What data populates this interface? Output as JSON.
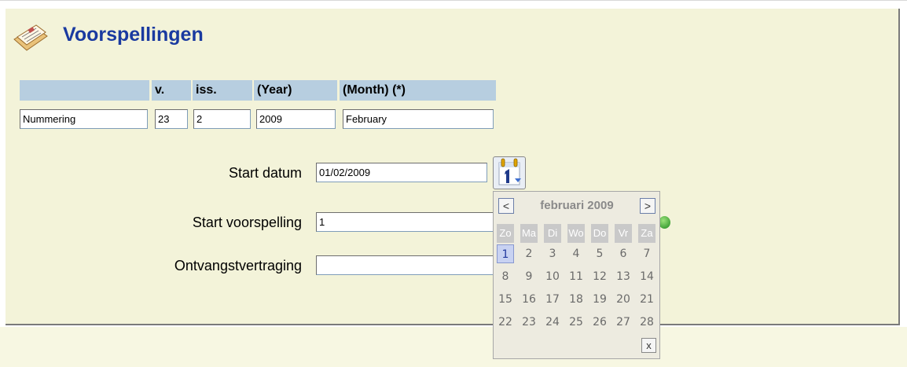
{
  "page": {
    "title": "Voorspellingen"
  },
  "table": {
    "headers": [
      "",
      "v.",
      "iss.",
      "(Year)",
      "(Month) (*)"
    ],
    "row": [
      "Nummering",
      "23",
      "2",
      "2009",
      "February"
    ]
  },
  "form": {
    "start_datum_label": "Start datum",
    "start_datum_value": "01/02/2009",
    "start_voorspelling_label": "Start voorspelling",
    "start_voorspelling_value": "1",
    "ontvangstvertraging_label": "Ontvangstvertraging",
    "ontvangstvertraging_value": ""
  },
  "calendar": {
    "button_icon": "calendar-icon",
    "prev_label": "<",
    "next_label": ">",
    "month_label": "februari 2009",
    "close_label": "x",
    "day_names": [
      "Zo",
      "Ma",
      "Di",
      "Wo",
      "Do",
      "Vr",
      "Za"
    ],
    "weeks": [
      [
        "1",
        "2",
        "3",
        "4",
        "5",
        "6",
        "7"
      ],
      [
        "8",
        "9",
        "10",
        "11",
        "12",
        "13",
        "14"
      ],
      [
        "15",
        "16",
        "17",
        "18",
        "19",
        "20",
        "21"
      ],
      [
        "22",
        "23",
        "24",
        "25",
        "26",
        "27",
        "28"
      ]
    ],
    "selected_day": "1"
  },
  "icons": {
    "logo": "newspaper-icon",
    "status": "green-dot-icon"
  },
  "colors": {
    "title": "#1a3aa0",
    "header_bg": "#b7cee0",
    "panel_bg": "#f3f3d9"
  }
}
